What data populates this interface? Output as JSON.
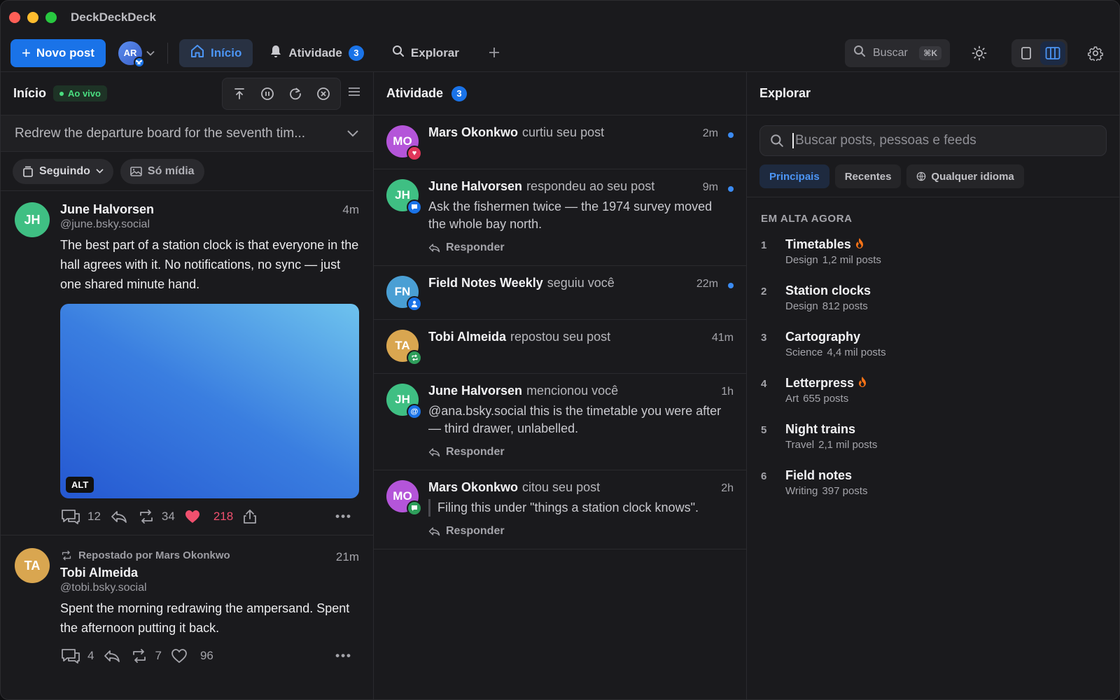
{
  "app": {
    "title": "DeckDeckDeck"
  },
  "toolbar": {
    "new_post": "Novo post",
    "account_initials": "AR",
    "tabs": [
      {
        "label": "Início",
        "active": true
      },
      {
        "label": "Atividade",
        "badge": "3"
      },
      {
        "label": "Explorar"
      }
    ],
    "search_label": "Buscar",
    "search_shortcut": "⌘K"
  },
  "home": {
    "title": "Início",
    "live_label": "Ao vivo",
    "draft_preview": "Redrew the departure board for the seventh tim...",
    "filter_following": "Seguindo",
    "filter_media": "Só mídia",
    "posts": [
      {
        "initials": "JH",
        "author": "June Halvorsen",
        "handle": "@june.bsky.social",
        "time": "4m",
        "text": "The best part of a station clock is that everyone in the hall agrees with it. No notifications, no sync — just one shared minute hand.",
        "alt_badge": "ALT",
        "replies": "12",
        "reposts": "34",
        "likes": "218"
      },
      {
        "initials": "TA",
        "repost_by": "Repostado por Mars Okonkwo",
        "author": "Tobi Almeida",
        "handle": "@tobi.bsky.social",
        "time": "21m",
        "text": "Spent the morning redrawing the ampersand. Spent the afternoon putting it back.",
        "replies": "4",
        "reposts": "7",
        "likes": "96"
      }
    ]
  },
  "activity": {
    "title": "Atividade",
    "badge": "3",
    "reply_label": "Responder",
    "items": [
      {
        "initials": "MO",
        "who": "Mars Okonkwo",
        "action": "curtiu seu post",
        "time": "2m"
      },
      {
        "initials": "JH",
        "who": "June Halvorsen",
        "action": "respondeu ao seu post",
        "time": "9m",
        "text": "Ask the fishermen twice — the 1974 survey moved the whole bay north."
      },
      {
        "initials": "FN",
        "who": "Field Notes Weekly",
        "action": "seguiu você",
        "time": "22m"
      },
      {
        "initials": "TA",
        "who": "Tobi Almeida",
        "action": "repostou seu post",
        "time": "41m"
      },
      {
        "initials": "JH",
        "who": "June Halvorsen",
        "action": "mencionou você",
        "time": "1h",
        "text": "@ana.bsky.social this is the timetable you were after — third drawer, unlabelled."
      },
      {
        "initials": "MO",
        "who": "Mars Okonkwo",
        "action": "citou seu post",
        "time": "2h",
        "text": "Filing this under \"things a station clock knows\"."
      }
    ]
  },
  "explore": {
    "title": "Explorar",
    "search_placeholder": "Buscar posts, pessoas e feeds",
    "tabs": [
      "Principais",
      "Recentes",
      "Qualquer idioma"
    ],
    "trending_header": "EM ALTA AGORA",
    "trends": [
      {
        "rank": "1",
        "name": "Timetables",
        "category": "Design",
        "count": "1,2 mil posts",
        "hot": true
      },
      {
        "rank": "2",
        "name": "Station clocks",
        "category": "Design",
        "count": "812 posts"
      },
      {
        "rank": "3",
        "name": "Cartography",
        "category": "Science",
        "count": "4,4 mil posts"
      },
      {
        "rank": "4",
        "name": "Letterpress",
        "category": "Art",
        "count": "655 posts",
        "hot": true
      },
      {
        "rank": "5",
        "name": "Night trains",
        "category": "Travel",
        "count": "2,1 mil posts"
      },
      {
        "rank": "6",
        "name": "Field notes",
        "category": "Writing",
        "count": "397 posts"
      }
    ]
  },
  "colors": {
    "accent": "#1a73e8",
    "like": "#f0506e",
    "live": "#4ade80"
  }
}
